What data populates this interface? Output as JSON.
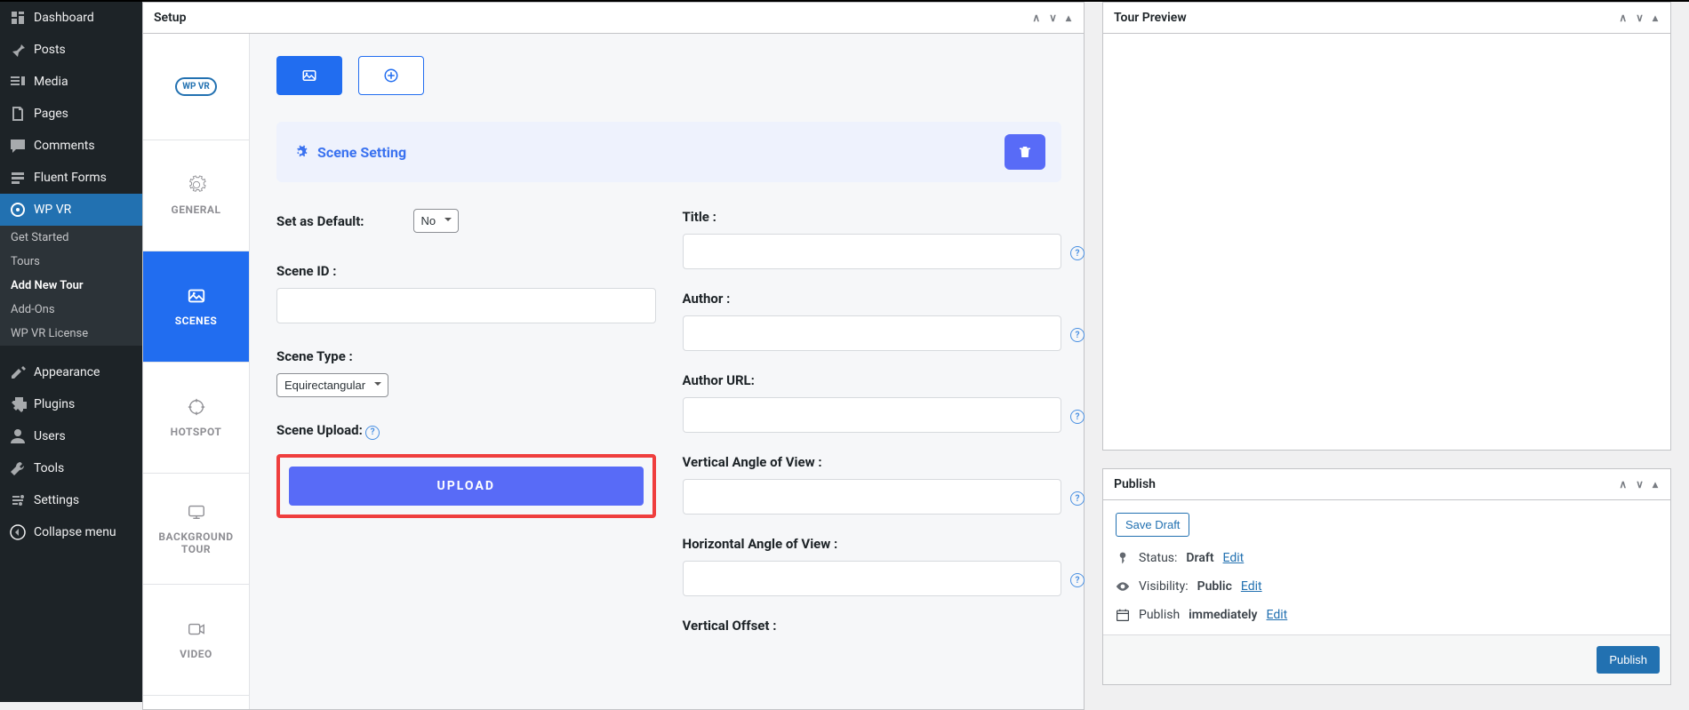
{
  "sidebar": {
    "items": [
      {
        "label": "Dashboard",
        "icon": "dashboard"
      },
      {
        "label": "Posts",
        "icon": "pin"
      },
      {
        "label": "Media",
        "icon": "media"
      },
      {
        "label": "Pages",
        "icon": "pages"
      },
      {
        "label": "Comments",
        "icon": "comment"
      },
      {
        "label": "Fluent Forms",
        "icon": "forms"
      },
      {
        "label": "WP VR",
        "icon": "vr",
        "active": true
      }
    ],
    "sub": [
      {
        "label": "Get Started"
      },
      {
        "label": "Tours"
      },
      {
        "label": "Add New Tour",
        "current": true
      },
      {
        "label": "Add-Ons"
      },
      {
        "label": "WP VR License"
      }
    ],
    "items2": [
      {
        "label": "Appearance",
        "icon": "appearance"
      },
      {
        "label": "Plugins",
        "icon": "plugins"
      },
      {
        "label": "Users",
        "icon": "users"
      },
      {
        "label": "Tools",
        "icon": "tools"
      },
      {
        "label": "Settings",
        "icon": "settings"
      },
      {
        "label": "Collapse menu",
        "icon": "collapse"
      }
    ]
  },
  "setup": {
    "title": "Setup",
    "brand": "WP VR",
    "vtabs": [
      {
        "label": "GENERAL",
        "icon": "gear"
      },
      {
        "label": "SCENES",
        "icon": "image",
        "active": true
      },
      {
        "label": "HOTSPOT",
        "icon": "target"
      },
      {
        "label": "BACKGROUND TOUR",
        "icon": "display"
      },
      {
        "label": "VIDEO",
        "icon": "video"
      }
    ],
    "scene_header": "Scene Setting",
    "fields": {
      "set_default_label": "Set as Default:",
      "set_default_value": "No",
      "scene_id_label": "Scene ID :",
      "scene_id_value": "",
      "scene_type_label": "Scene Type :",
      "scene_type_value": "Equirectangular",
      "scene_upload_label": "Scene Upload:",
      "upload_btn": "UPLOAD",
      "title_label": "Title :",
      "title_value": "",
      "author_label": "Author :",
      "author_value": "",
      "author_url_label": "Author URL:",
      "author_url_value": "",
      "vaov_label": "Vertical Angle of View :",
      "vaov_value": "",
      "haov_label": "Horizontal Angle of View :",
      "haov_value": "",
      "voffset_label": "Vertical Offset :"
    }
  },
  "tour_preview": {
    "title": "Tour Preview"
  },
  "publish": {
    "title": "Publish",
    "save_draft": "Save Draft",
    "status_label": "Status:",
    "status_value": "Draft",
    "status_edit": "Edit",
    "visibility_label": "Visibility:",
    "visibility_value": "Public",
    "visibility_edit": "Edit",
    "schedule_label": "Publish",
    "schedule_value": "immediately",
    "schedule_edit": "Edit",
    "publish_btn": "Publish"
  }
}
